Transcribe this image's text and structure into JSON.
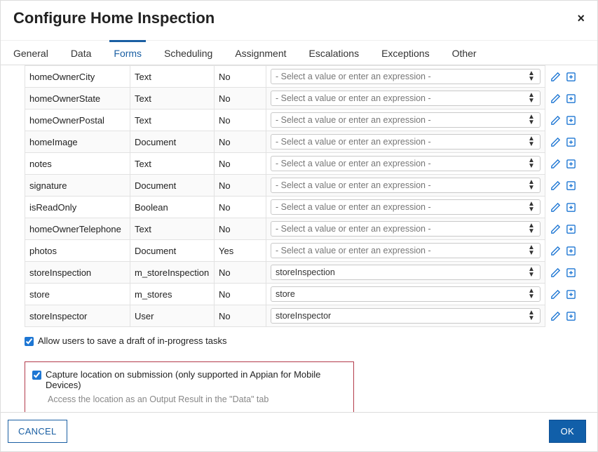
{
  "dialog": {
    "title": "Configure Home Inspection",
    "close_icon": "×"
  },
  "tabs": [
    {
      "label": "General",
      "active": false
    },
    {
      "label": "Data",
      "active": false
    },
    {
      "label": "Forms",
      "active": true
    },
    {
      "label": "Scheduling",
      "active": false
    },
    {
      "label": "Assignment",
      "active": false
    },
    {
      "label": "Escalations",
      "active": false
    },
    {
      "label": "Exceptions",
      "active": false
    },
    {
      "label": "Other",
      "active": false
    }
  ],
  "select_placeholder": "- Select a value or enter an expression -",
  "rows": [
    {
      "name": "homeOwnerCity",
      "type": "Text",
      "multiple": "No",
      "value": "",
      "placeholder": true
    },
    {
      "name": "homeOwnerState",
      "type": "Text",
      "multiple": "No",
      "value": "",
      "placeholder": true
    },
    {
      "name": "homeOwnerPostal",
      "type": "Text",
      "multiple": "No",
      "value": "",
      "placeholder": true
    },
    {
      "name": "homeImage",
      "type": "Document",
      "multiple": "No",
      "value": "",
      "placeholder": true
    },
    {
      "name": "notes",
      "type": "Text",
      "multiple": "No",
      "value": "",
      "placeholder": true
    },
    {
      "name": "signature",
      "type": "Document",
      "multiple": "No",
      "value": "",
      "placeholder": true
    },
    {
      "name": "isReadOnly",
      "type": "Boolean",
      "multiple": "No",
      "value": "",
      "placeholder": true
    },
    {
      "name": "homeOwnerTelephone",
      "type": "Text",
      "multiple": "No",
      "value": "",
      "placeholder": true
    },
    {
      "name": "photos",
      "type": "Document",
      "multiple": "Yes",
      "value": "",
      "placeholder": true
    },
    {
      "name": "storeInspection",
      "type": "m_storeInspection",
      "multiple": "No",
      "value": "storeInspection",
      "placeholder": false
    },
    {
      "name": "store",
      "type": "m_stores",
      "multiple": "No",
      "value": "store",
      "placeholder": false
    },
    {
      "name": "storeInspector",
      "type": "User",
      "multiple": "No",
      "value": "storeInspector",
      "placeholder": false
    }
  ],
  "options": {
    "allow_draft_label": "Allow users to save a draft of in-progress tasks",
    "allow_draft_checked": true,
    "capture_location_label": "Capture location on submission (only supported in Appian for Mobile Devices)",
    "capture_location_checked": true,
    "capture_location_hint": "Access the location as an Output Result in the \"Data\" tab"
  },
  "buttons": {
    "cancel": "CANCEL",
    "ok": "OK"
  },
  "colors": {
    "accent": "#1a5fa3",
    "link": "#1d76d3",
    "highlight_border": "#b33b4b"
  }
}
